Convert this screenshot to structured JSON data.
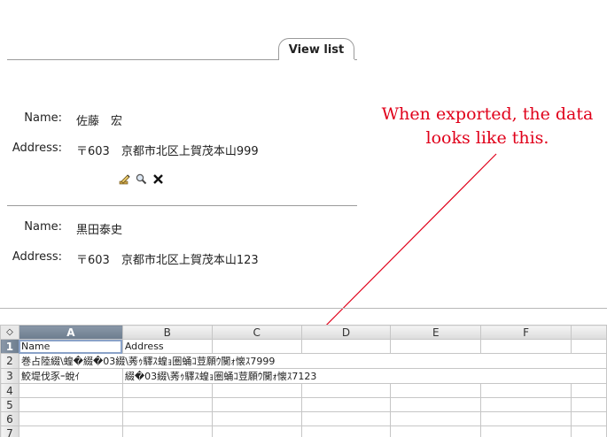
{
  "tab": {
    "label": "View list"
  },
  "records": [
    {
      "name_label": "Name:",
      "name_value": "佐藤　宏",
      "address_label": "Address:",
      "address_value": "〒603　京都市北区上賀茂本山999"
    },
    {
      "name_label": "Name:",
      "name_value": "黒田泰史",
      "address_label": "Address:",
      "address_value": "〒603　京都市北区上賀茂本山123"
    }
  ],
  "record_icons": [
    "edit-icon",
    "magnifier-icon",
    "delete-x-icon"
  ],
  "annotation": {
    "line1": "When exported, the data",
    "line2": "looks like this.",
    "color": "#e0001a"
  },
  "spreadsheet": {
    "corner": "◇",
    "columns": [
      "A",
      "B",
      "C",
      "D",
      "E",
      "F"
    ],
    "active_column": "A",
    "rows": [
      "1",
      "2",
      "3",
      "4",
      "5",
      "6",
      "7"
    ],
    "active_row": "1",
    "cells": {
      "A1": "Name",
      "B1": "Address",
      "A2": "巻占陸綴\\蝗�綴�03綴\\莠ｩ驛ｽ蝗ｮ圏蛹ｺ荳願ｳ闃ｫ懐ｽ7999",
      "A3": "鮫堤伐豕ｰ蛻ｲ",
      "B3": "綴�03綴\\莠ｩ驛ｽ蝗ｮ圏蛹ｺ荳願ｳ闃ｫ懐ｽ7123"
    }
  }
}
